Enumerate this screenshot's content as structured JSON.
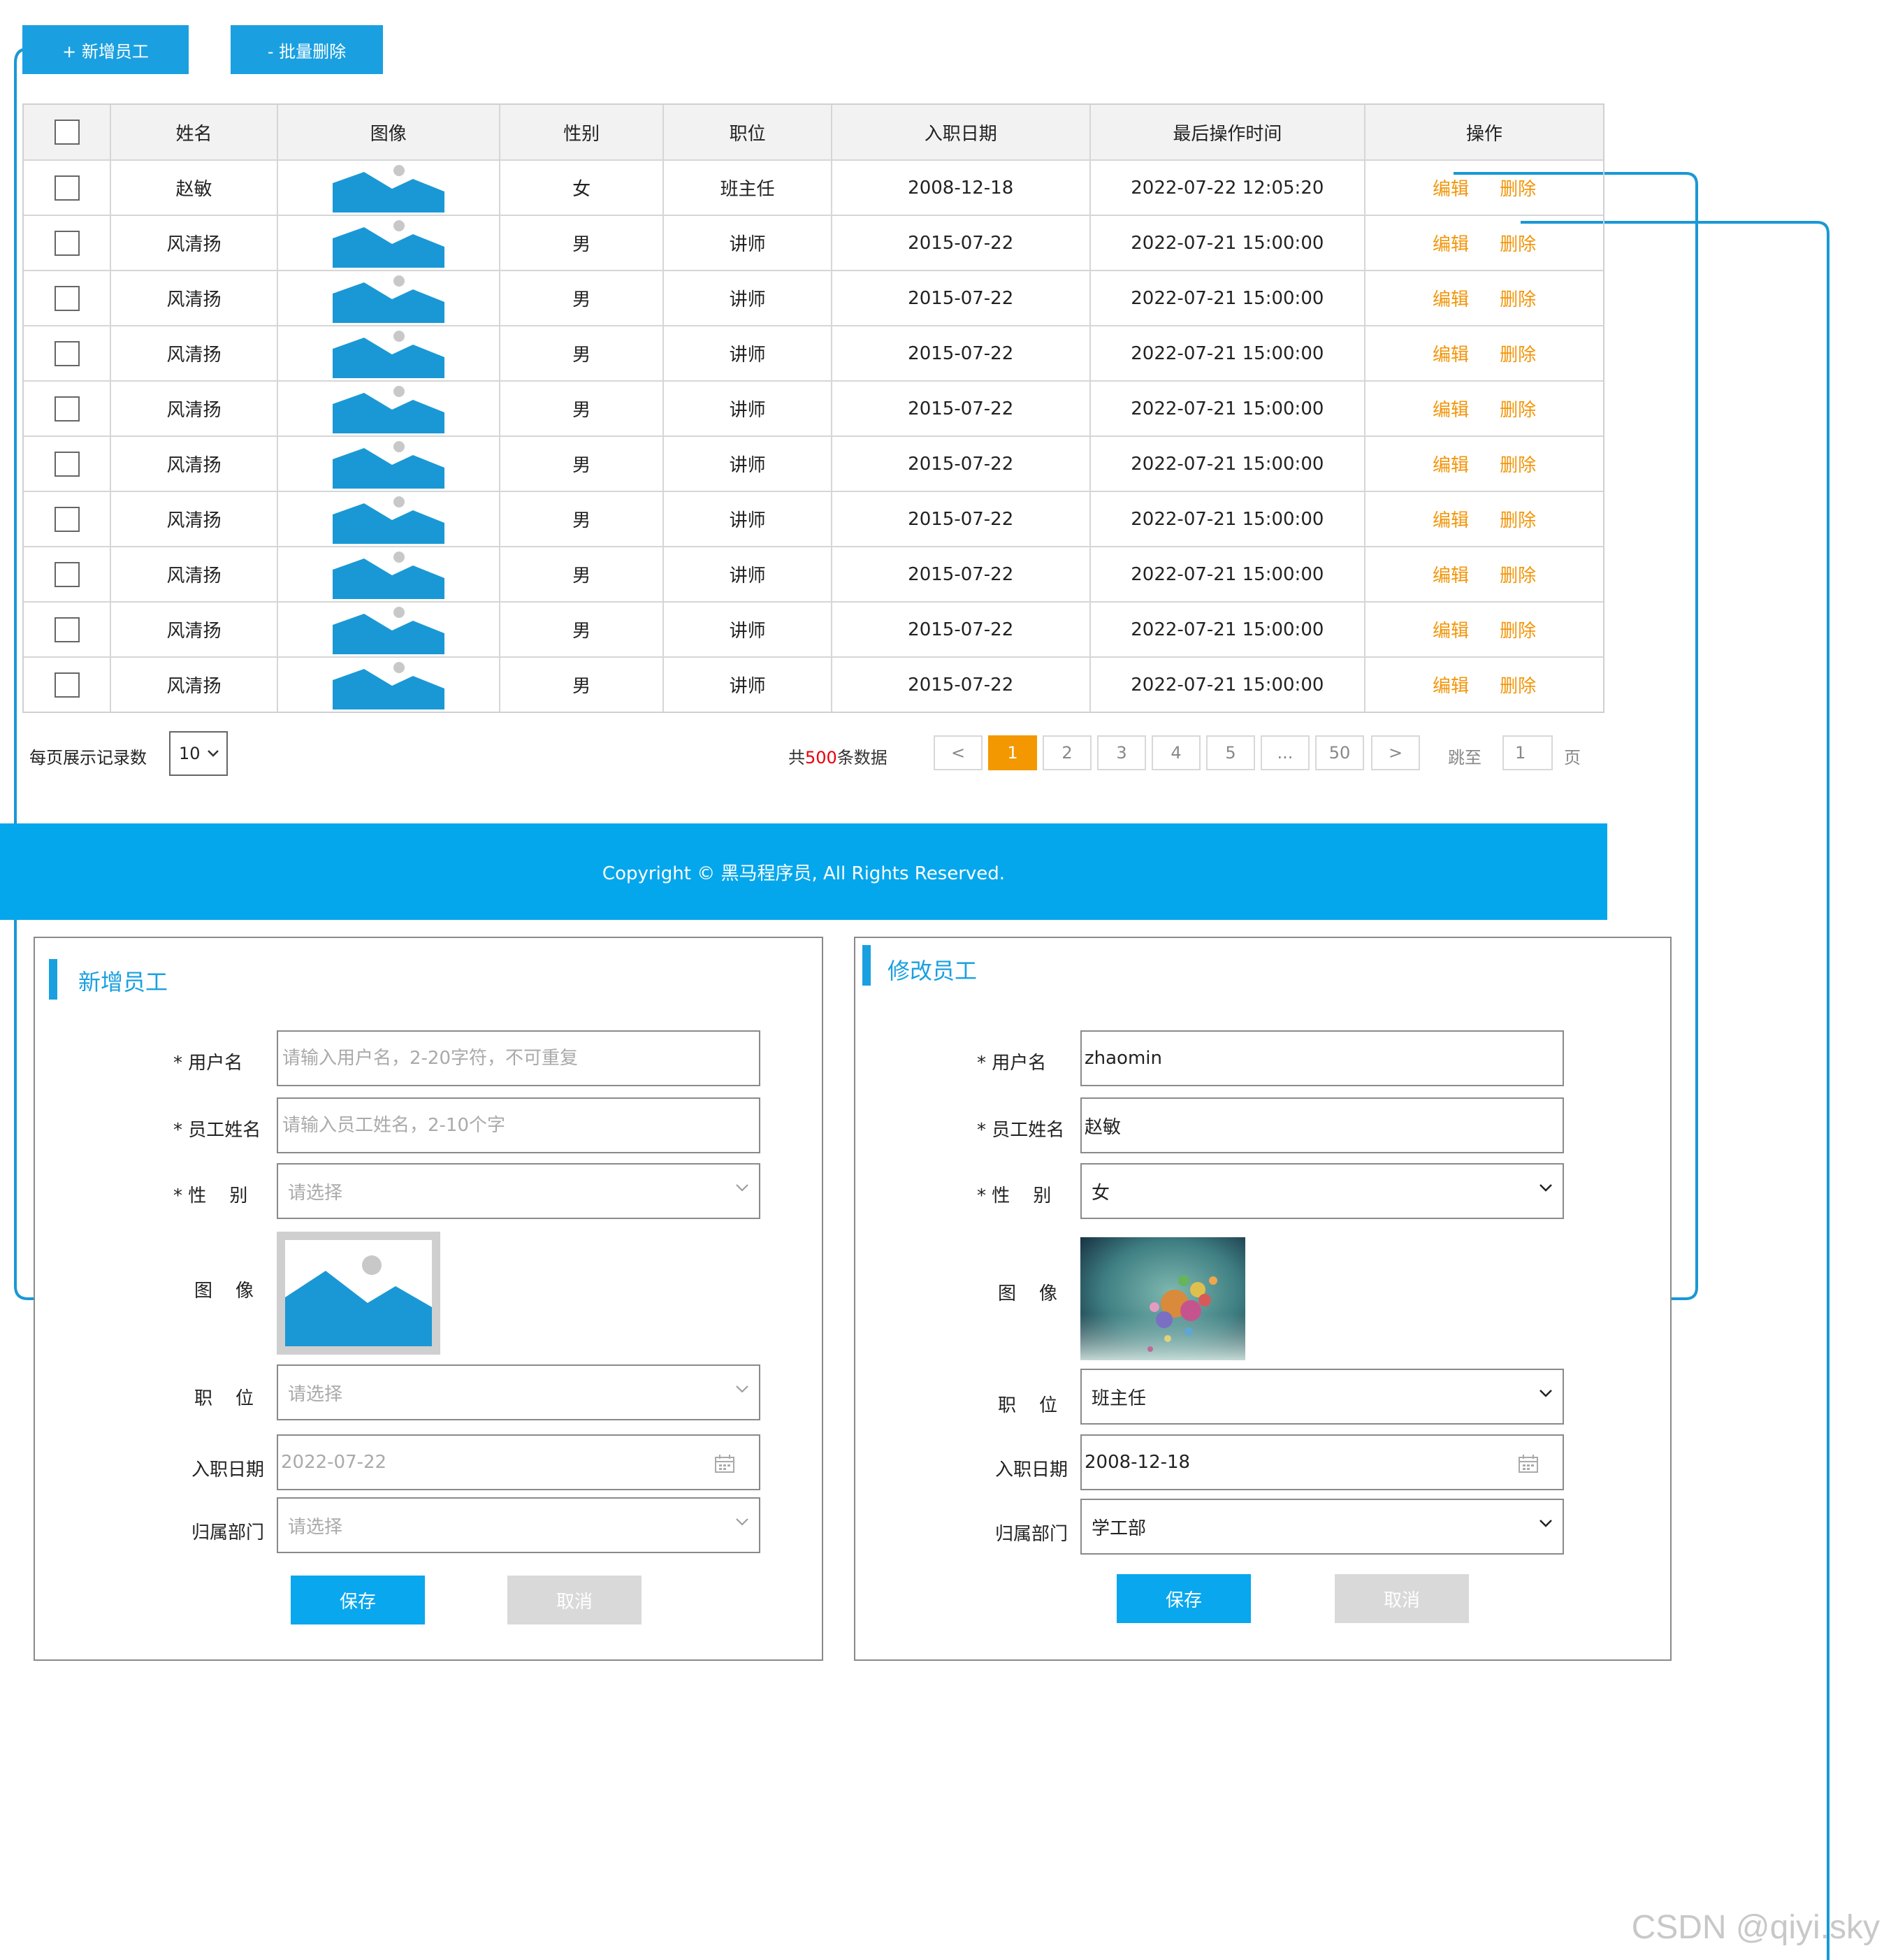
{
  "toolbar": {
    "add_label": "+ 新增员工",
    "batch_delete_label": "- 批量删除"
  },
  "table": {
    "headers": [
      "姓名",
      "图像",
      "性别",
      "职位",
      "入职日期",
      "最后操作时间",
      "操作"
    ],
    "rows": [
      {
        "name": "赵敏",
        "gender": "女",
        "position": "班主任",
        "entry_date": "2008-12-18",
        "last_op": "2022-07-22 12:05:20"
      },
      {
        "name": "风清扬",
        "gender": "男",
        "position": "讲师",
        "entry_date": "2015-07-22",
        "last_op": "2022-07-21 15:00:00"
      },
      {
        "name": "风清扬",
        "gender": "男",
        "position": "讲师",
        "entry_date": "2015-07-22",
        "last_op": "2022-07-21 15:00:00"
      },
      {
        "name": "风清扬",
        "gender": "男",
        "position": "讲师",
        "entry_date": "2015-07-22",
        "last_op": "2022-07-21 15:00:00"
      },
      {
        "name": "风清扬",
        "gender": "男",
        "position": "讲师",
        "entry_date": "2015-07-22",
        "last_op": "2022-07-21 15:00:00"
      },
      {
        "name": "风清扬",
        "gender": "男",
        "position": "讲师",
        "entry_date": "2015-07-22",
        "last_op": "2022-07-21 15:00:00"
      },
      {
        "name": "风清扬",
        "gender": "男",
        "position": "讲师",
        "entry_date": "2015-07-22",
        "last_op": "2022-07-21 15:00:00"
      },
      {
        "name": "风清扬",
        "gender": "男",
        "position": "讲师",
        "entry_date": "2015-07-22",
        "last_op": "2022-07-21 15:00:00"
      },
      {
        "name": "风清扬",
        "gender": "男",
        "position": "讲师",
        "entry_date": "2015-07-22",
        "last_op": "2022-07-21 15:00:00"
      },
      {
        "name": "风清扬",
        "gender": "男",
        "position": "讲师",
        "entry_date": "2015-07-22",
        "last_op": "2022-07-21 15:00:00"
      }
    ],
    "edit_label": "编辑",
    "delete_label": "删除"
  },
  "pagination": {
    "per_page_label": "每页展示记录数",
    "per_page_value": "10",
    "total_prefix": "共",
    "total_count": "500",
    "total_suffix": "条数据",
    "prev": "<",
    "pages": [
      "1",
      "2",
      "3",
      "4",
      "5",
      "...",
      "50"
    ],
    "next": ">",
    "jump_label": "跳至",
    "jump_value": "1",
    "page_suffix": "页"
  },
  "footer": {
    "text": "Copyright © 黑马程序员, All Rights Reserved."
  },
  "add_form": {
    "title": "新增员工",
    "username_label": "* 用户名",
    "username_placeholder": "请输入用户名，2-20字符，不可重复",
    "name_label": "* 员工姓名",
    "name_placeholder": "请输入员工姓名，2-10个字",
    "gender_label": "* 性    别",
    "gender_placeholder": "请选择",
    "image_label": "图    像",
    "position_label": "职    位",
    "position_placeholder": "请选择",
    "date_label": "入职日期",
    "date_placeholder": "2022-07-22",
    "dept_label": "归属部门",
    "dept_placeholder": "请选择",
    "save_label": "保存",
    "cancel_label": "取消"
  },
  "edit_form": {
    "title": "修改员工",
    "username_label": "* 用户名",
    "username_value": "zhaomin",
    "name_label": "* 员工姓名",
    "name_value": "赵敏",
    "gender_label": "* 性    别",
    "gender_value": "女",
    "image_label": "图    像",
    "position_label": "职    位",
    "position_value": "班主任",
    "date_label": "入职日期",
    "date_value": "2008-12-18",
    "dept_label": "归属部门",
    "dept_value": "学工部",
    "save_label": "保存",
    "cancel_label": "取消"
  },
  "watermark": "CSDN @qiyi.sky",
  "colors": {
    "primary": "#1aa0e0",
    "footer": "#05a7ec",
    "action": "#f2960b",
    "active_page": "#f39800",
    "total_count": "#e8000b"
  }
}
